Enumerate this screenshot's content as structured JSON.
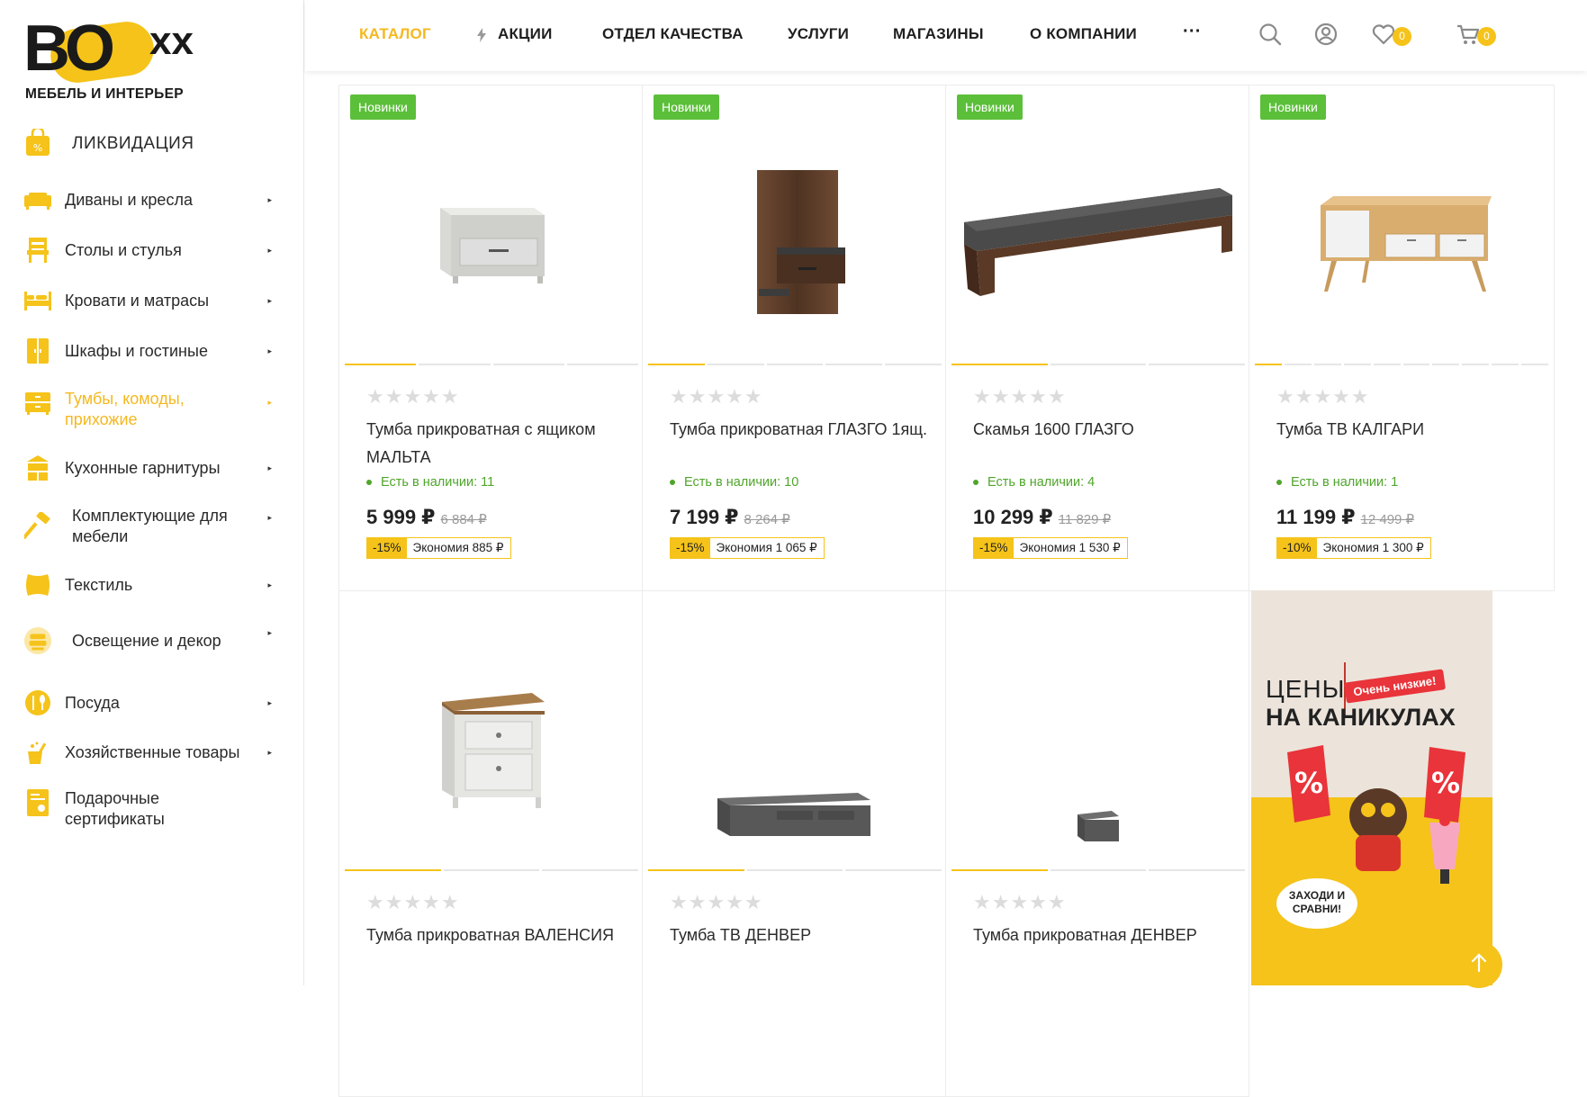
{
  "logo": {
    "word": "BO",
    "x": "xx",
    "subtitle": "МЕБЕЛЬ И ИНТЕРЬЕР"
  },
  "sidebar": {
    "liquidation": "ЛИКВИДАЦИЯ",
    "items": [
      {
        "label": "Диваны и кресла"
      },
      {
        "label": "Столы и стулья"
      },
      {
        "label": "Кровати и матрасы"
      },
      {
        "label": "Шкафы и гостиные"
      },
      {
        "label": "Тумбы, комоды, прихожие"
      },
      {
        "label": "Кухонные гарнитуры"
      },
      {
        "label": "Комплектующие для мебели"
      },
      {
        "label": "Текстиль"
      },
      {
        "label": "Освещение и декор"
      },
      {
        "label": "Посуда"
      },
      {
        "label": "Хозяйственные товары"
      },
      {
        "label": "Подарочные сертификаты"
      }
    ],
    "arrow": "▸"
  },
  "nav": {
    "catalog": "КАТАЛОГ",
    "sales": "АКЦИИ",
    "quality": "ОТДЕЛ КАЧЕСТВА",
    "services": "УСЛУГИ",
    "stores": "МАГАЗИНЫ",
    "about": "О КОМПАНИИ",
    "more": "···",
    "wishlist_count": "0",
    "cart_count": "0"
  },
  "products": [
    {
      "badge": "Новинки",
      "stars": "★★★★★",
      "title": "Тумба прикроватная с ящиком МАЛЬТА",
      "stock": "Есть в наличии: 11",
      "price": "5 999 ₽",
      "old_price": "6 884 ₽",
      "discount": "-15%",
      "savings": "Экономия 885 ₽"
    },
    {
      "badge": "Новинки",
      "stars": "★★★★★",
      "title": "Тумба прикроватная ГЛАЗГО 1ящ.",
      "stock": "Есть в наличии: 10",
      "price": "7 199 ₽",
      "old_price": "8 264 ₽",
      "discount": "-15%",
      "savings": "Экономия 1 065 ₽"
    },
    {
      "badge": "Новинки",
      "stars": "★★★★★",
      "title": "Скамья 1600 ГЛАЗГО",
      "stock": "Есть в наличии: 4",
      "price": "10 299 ₽",
      "old_price": "11 829 ₽",
      "discount": "-15%",
      "savings": "Экономия 1 530 ₽"
    },
    {
      "badge": "Новинки",
      "stars": "★★★★★",
      "title": "Тумба ТВ КАЛГАРИ",
      "stock": "Есть в наличии: 1",
      "price": "11 199 ₽",
      "old_price": "12 499 ₽",
      "discount": "-10%",
      "savings": "Экономия 1 300 ₽"
    },
    {
      "stars": "★★★★★",
      "title": "Тумба прикроватная ВАЛЕНСИЯ"
    },
    {
      "stars": "★★★★★",
      "title": "Тумба ТВ ДЕНВЕР"
    },
    {
      "stars": "★★★★★",
      "title": "Тумба прикроватная ДЕНВЕР"
    }
  ],
  "promo": {
    "line1": "ЦЕНЫ",
    "line2": "НА КАНИКУЛАХ",
    "flag": "Очень низкие!",
    "bubble": "ЗАХОДИ И СРАВНИ!"
  },
  "colors": {
    "accent": "#f5c31a",
    "accent_text": "#f5b820",
    "in_stock": "#4fa52a",
    "new_badge": "#5bbf3a"
  }
}
